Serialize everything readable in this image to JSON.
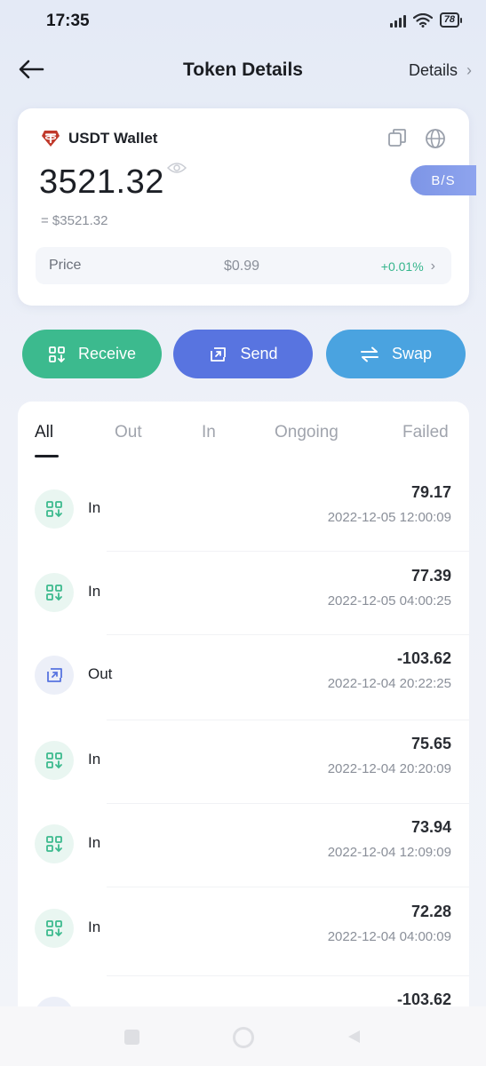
{
  "status_bar": {
    "time": "17:35",
    "battery": "78"
  },
  "nav": {
    "title": "Token Details",
    "details_label": "Details"
  },
  "wallet": {
    "name": "USDT Wallet",
    "balance": "3521.32",
    "fiat": "= $3521.32",
    "bs_label": "B/S",
    "price_label": "Price",
    "price_value": "$0.99",
    "price_change": "+0.01%"
  },
  "actions": {
    "receive": "Receive",
    "send": "Send",
    "swap": "Swap"
  },
  "tabs": [
    "All",
    "Out",
    "In",
    "Ongoing",
    "Failed"
  ],
  "transactions": [
    {
      "type": "In",
      "amount": "79.17",
      "date": "2022-12-05 12:00:09",
      "icon": "receive-qr-icon"
    },
    {
      "type": "In",
      "amount": "77.39",
      "date": "2022-12-05 04:00:25",
      "icon": "receive-qr-icon"
    },
    {
      "type": "Out",
      "amount": "-103.62",
      "date": "2022-12-04 20:22:25",
      "icon": "send-arrow-icon"
    },
    {
      "type": "In",
      "amount": "75.65",
      "date": "2022-12-04 20:20:09",
      "icon": "receive-qr-icon"
    },
    {
      "type": "In",
      "amount": "73.94",
      "date": "2022-12-04 12:09:09",
      "icon": "receive-qr-icon"
    },
    {
      "type": "In",
      "amount": "72.28",
      "date": "2022-12-04 04:00:09",
      "icon": "receive-qr-icon"
    },
    {
      "type": "",
      "amount": "-103.62",
      "date": "",
      "icon": "send-arrow-icon"
    }
  ],
  "colors": {
    "receive": "#3cba8e",
    "send": "#5874e0",
    "swap": "#4aa3e0",
    "positive": "#35b58c",
    "tether": "#c0392b"
  }
}
